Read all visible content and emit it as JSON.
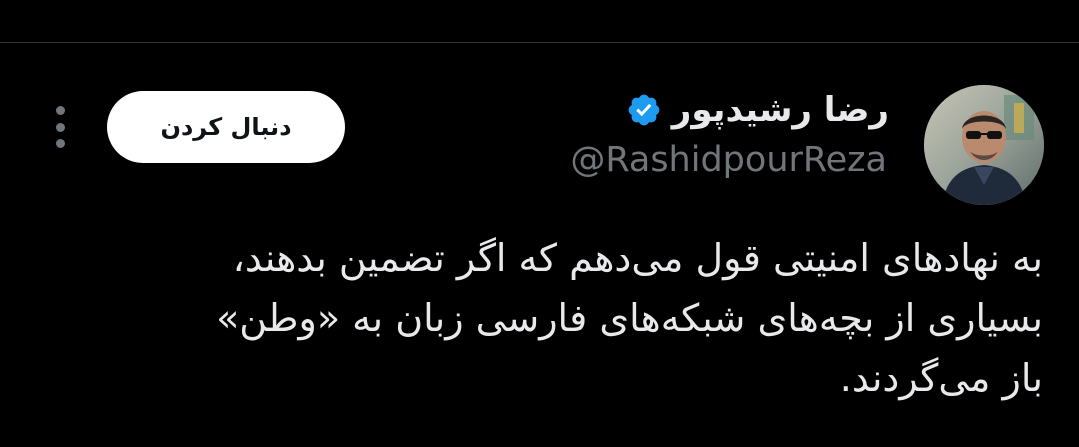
{
  "colors": {
    "background": "#000000",
    "text_primary": "#e7e9ea",
    "text_secondary": "#71767b",
    "divider": "#2f3336",
    "verified": "#1d9bf0",
    "follow_button_bg": "#ffffff",
    "follow_button_text": "#0f1419"
  },
  "author": {
    "display_name": "رضا رشیدپور",
    "handle": "@RashidpourReza",
    "verified": true,
    "avatar_icon": "avatar-photo"
  },
  "actions": {
    "follow_label": "دنبال کردن",
    "more_icon": "more-vertical-icon"
  },
  "tweet": {
    "lines": [
      "به نهادهای امنیتی قول می‌دهم که اگر تضمین بدهند،",
      "بسیاری از بچه‌های شبکه‌های فارسی زبان به «وطن»",
      "باز می‌گردند."
    ]
  }
}
